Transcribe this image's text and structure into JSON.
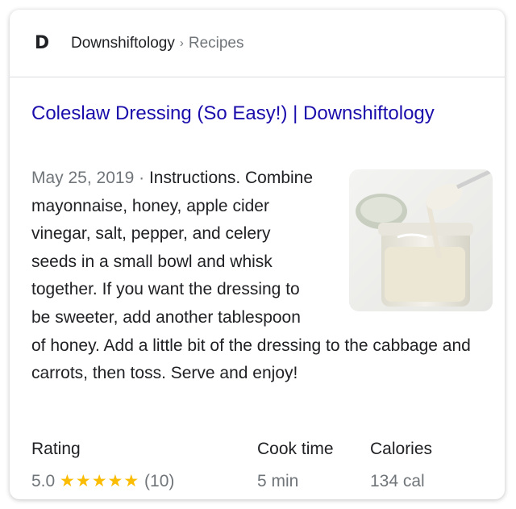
{
  "header": {
    "favicon_letter": "D",
    "site_name": "Downshiftology",
    "separator": "›",
    "breadcrumb": "Recipes"
  },
  "result": {
    "title": "Coleslaw Dressing (So Easy!) | Downshiftology",
    "date": "May 25, 2019",
    "date_separator": " · ",
    "snippet": "Instructions. Combine mayonnaise, honey, apple cider vinegar, salt, pepper, and celery seeds in a small bowl and whisk together. If you want the dressing to be sweeter, add another tablespoon of honey. Add a little bit of the dressing to the cabbage and carrots, then toss. Serve and enjoy!"
  },
  "facts": {
    "rating": {
      "label": "Rating",
      "value": "5.0",
      "stars": "★★★★★",
      "star_fraction": 1.0,
      "count": "(10)"
    },
    "cook_time": {
      "label": "Cook time",
      "value": "5 min"
    },
    "calories": {
      "label": "Calories",
      "value": "134 cal"
    }
  },
  "colors": {
    "link": "#1a0dab",
    "star": "#fbbc04",
    "muted": "#70757a",
    "text": "#202124"
  }
}
